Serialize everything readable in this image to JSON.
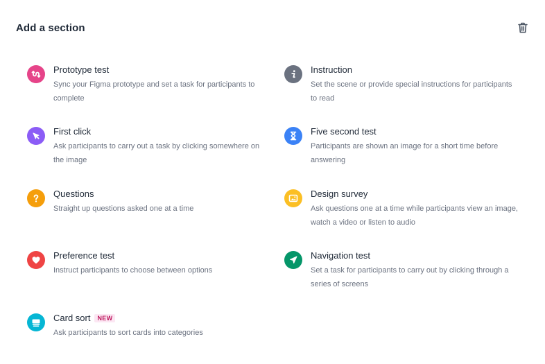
{
  "header": {
    "title": "Add a section",
    "delete_icon": "trash-icon"
  },
  "options": [
    {
      "key": "prototype",
      "title": "Prototype test",
      "description": "Sync your Figma prototype and set a task for participants to complete",
      "icon": "prototype-icon",
      "color": "#e64489"
    },
    {
      "key": "instruction",
      "title": "Instruction",
      "description": "Set the scene or provide special instructions for participants to read",
      "icon": "info-icon",
      "color": "#6b7280"
    },
    {
      "key": "first-click",
      "title": "First click",
      "description": "Ask participants to carry out a task by clicking somewhere on the image",
      "icon": "cursor-icon",
      "color": "#8b5cf6"
    },
    {
      "key": "five-second",
      "title": "Five second test",
      "description": "Participants are shown an image for a short time before answering",
      "icon": "hourglass-icon",
      "color": "#3b82f6"
    },
    {
      "key": "questions",
      "title": "Questions",
      "description": "Straight up questions asked one at a time",
      "icon": "question-icon",
      "color": "#f59e0b"
    },
    {
      "key": "design-survey",
      "title": "Design survey",
      "description": "Ask questions one at a time while participants view an image, watch a video or listen to audio",
      "icon": "image-icon",
      "color": "#fbbf24"
    },
    {
      "key": "preference",
      "title": "Preference test",
      "description": "Instruct participants to choose between options",
      "icon": "heart-icon",
      "color": "#ef4444"
    },
    {
      "key": "navigation",
      "title": "Navigation test",
      "description": "Set a task for participants to carry out by clicking through a series of screens",
      "icon": "navigation-arrow-icon",
      "color": "#059669"
    },
    {
      "key": "card-sort",
      "title": "Card sort",
      "badge": "NEW",
      "description": "Ask participants to sort cards into categories",
      "icon": "cards-icon",
      "color": "#06b6d4"
    }
  ]
}
